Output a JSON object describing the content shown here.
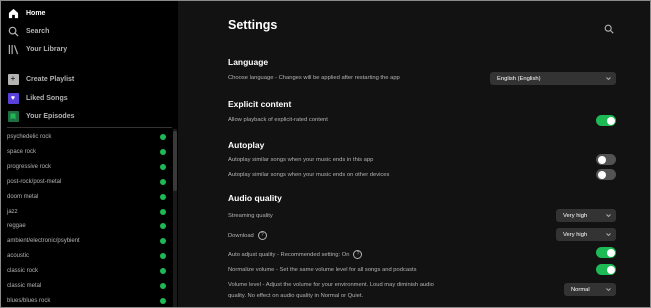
{
  "sidebar": {
    "nav": [
      {
        "label": "Home",
        "icon": "home-icon"
      },
      {
        "label": "Search",
        "icon": "search-icon"
      },
      {
        "label": "Your Library",
        "icon": "library-icon"
      }
    ],
    "actions": [
      {
        "label": "Create Playlist",
        "icon": "plus-icon",
        "color": "#b3b3b3"
      },
      {
        "label": "Liked Songs",
        "icon": "heart-icon",
        "color": "#5a3fd8"
      },
      {
        "label": "Your Episodes",
        "icon": "bookmark-icon",
        "color": "#1f6f43"
      }
    ],
    "playlists": [
      "psychedelic rock",
      "space rock",
      "progressive rock",
      "post-rock/post-metal",
      "doom metal",
      "jazz",
      "reggae",
      "ambient/electronic/psybient",
      "acoustic",
      "classic rock",
      "classic metal",
      "blues/blues rock"
    ]
  },
  "main": {
    "title": "Settings",
    "language": {
      "heading": "Language",
      "label": "Choose language - Changes will be applied after restarting the app",
      "value": "English (English)"
    },
    "explicit": {
      "heading": "Explicit content",
      "label": "Allow playback of explicit-rated content",
      "on": true
    },
    "autoplay": {
      "heading": "Autoplay",
      "row1": "Autoplay similar songs when your music ends in this app",
      "row1_on": false,
      "row2": "Autoplay similar songs when your music ends on other devices",
      "row2_on": false
    },
    "audio": {
      "heading": "Audio quality",
      "streaming_label": "Streaming quality",
      "streaming_value": "Very high",
      "download_label": "Download",
      "download_value": "Very high",
      "auto_adjust_label": "Auto adjust quality - Recommended setting: On",
      "auto_adjust_on": true,
      "normalize_label": "Normalize volume - Set the same volume level for all songs and podcasts",
      "normalize_on": true,
      "volume_label_1": "Volume level - Adjust the volume for your environment. Loud may diminish audio",
      "volume_label_2": "quality. No effect on audio quality in Normal or Quiet.",
      "volume_value": "Normal"
    }
  },
  "colors": {
    "accent": "#1db954",
    "background": "#121212",
    "sidebar": "#000000"
  }
}
